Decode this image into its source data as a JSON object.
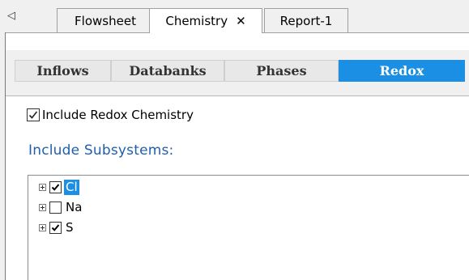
{
  "doc_tabs": {
    "flowsheet": "Flowsheet",
    "chemistry": "Chemistry",
    "report": "Report-1",
    "scroll_left_icon": "triangle-left-icon",
    "close_icon": "close-icon"
  },
  "subtabs": {
    "inflows": "Inflows",
    "databanks": "Databanks",
    "phases": "Phases",
    "redox": "Redox",
    "active": "Redox"
  },
  "redox": {
    "include_label": "Include Redox Chemistry",
    "include_checked": true
  },
  "subsystems": {
    "label": "Include Subsystems:",
    "items": [
      {
        "label": "Cl",
        "checked": true,
        "selected": true
      },
      {
        "label": "Na",
        "checked": false,
        "selected": false
      },
      {
        "label": "S",
        "checked": true,
        "selected": false
      }
    ]
  },
  "colors": {
    "accent": "#1a8fe3",
    "section_label": "#1f5fae"
  }
}
